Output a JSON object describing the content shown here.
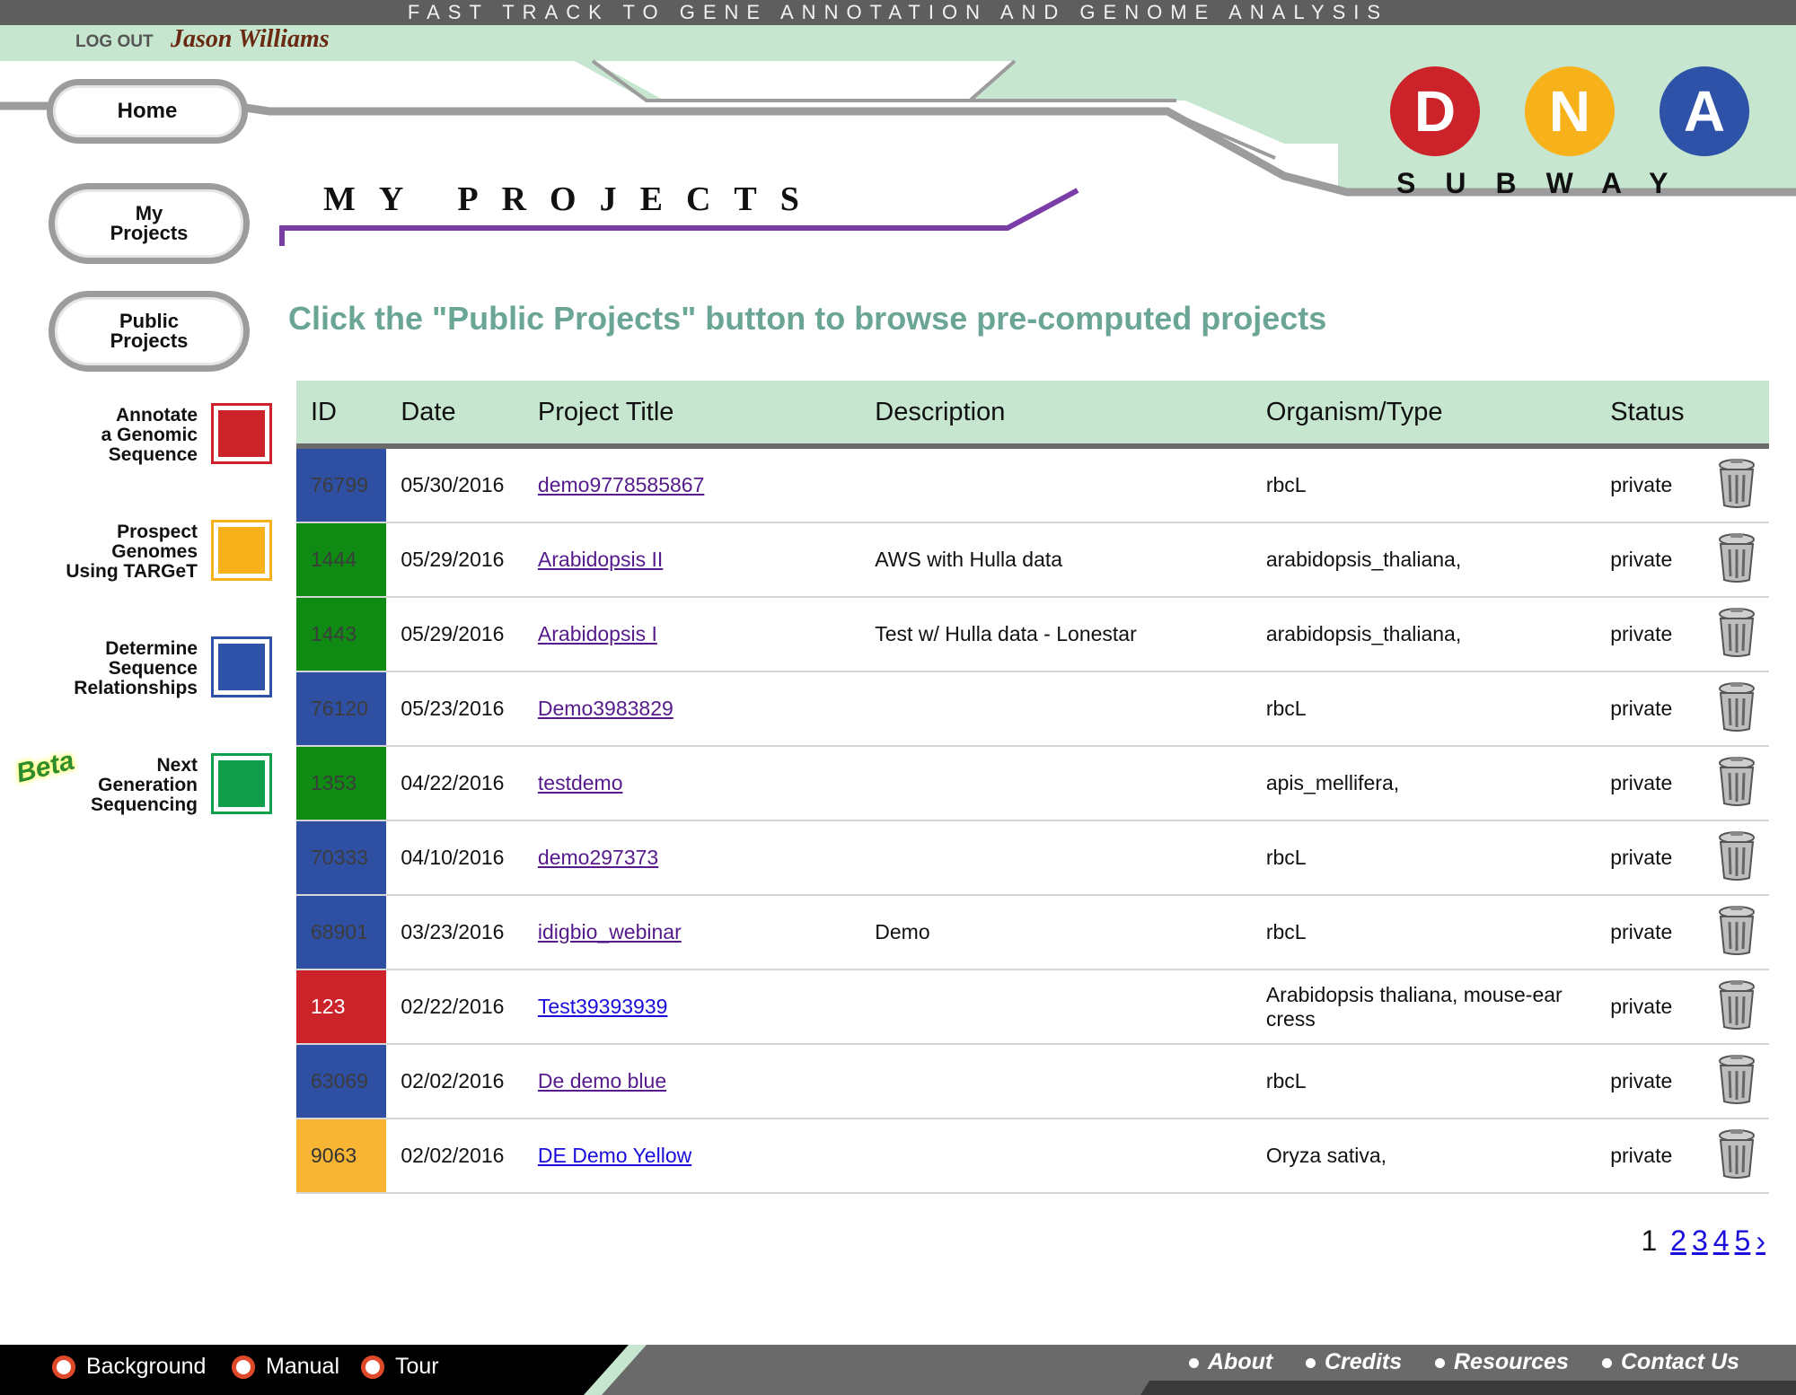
{
  "header": {
    "tagline": "FAST TRACK TO GENE ANNOTATION AND GENOME ANALYSIS",
    "logout_label": "LOG OUT",
    "username": "Jason Williams"
  },
  "logo": {
    "letters": [
      "D",
      "N",
      "A"
    ],
    "subtitle": "SUBWAY",
    "colors": [
      "#cc2229",
      "#f7b21b",
      "#2d52a8"
    ]
  },
  "nav": {
    "home": "Home",
    "my_projects": [
      "My",
      "Projects"
    ],
    "public_projects": [
      "Public",
      "Projects"
    ]
  },
  "sidebar": [
    {
      "lines": [
        "Annotate",
        "a Genomic",
        "Sequence"
      ],
      "color": "#cc2229"
    },
    {
      "lines": [
        "Prospect",
        "Genomes",
        "Using TARGeT"
      ],
      "color": "#f7b21b"
    },
    {
      "lines": [
        "Determine",
        "Sequence",
        "Relationships"
      ],
      "color": "#2d52a8"
    },
    {
      "lines": [
        "Next",
        "Generation",
        "Sequencing"
      ],
      "color": "#119e4a",
      "badge": "Beta"
    }
  ],
  "page": {
    "title": "MY PROJECTS",
    "instruction": "Click the \"Public Projects\" button to browse pre-computed projects"
  },
  "table": {
    "headers": [
      "ID",
      "Date",
      "Project Title",
      "Description",
      "Organism/Type",
      "Status"
    ],
    "rows": [
      {
        "id": "76799",
        "date": "05/30/2016",
        "title": "demo9778585867",
        "description": "",
        "organism": "rbcL",
        "status": "private",
        "color": "#2f4fa3"
      },
      {
        "id": "1444",
        "date": "05/29/2016",
        "title": "Arabidopsis II",
        "description": "AWS with Hulla data",
        "organism": "arabidopsis_thaliana,",
        "status": "private",
        "color": "#0f8a13"
      },
      {
        "id": "1443",
        "date": "05/29/2016",
        "title": "Arabidopsis I",
        "description": "Test w/ Hulla data - Lonestar",
        "organism": "arabidopsis_thaliana,",
        "status": "private",
        "color": "#0f8a13"
      },
      {
        "id": "76120",
        "date": "05/23/2016",
        "title": "Demo3983829",
        "description": "",
        "organism": "rbcL",
        "status": "private",
        "color": "#2f4fa3"
      },
      {
        "id": "1353",
        "date": "04/22/2016",
        "title": "testdemo",
        "description": "",
        "organism": "apis_mellifera,",
        "status": "private",
        "color": "#0f8a13"
      },
      {
        "id": "70333",
        "date": "04/10/2016",
        "title": "demo297373",
        "description": "",
        "organism": "rbcL",
        "status": "private",
        "color": "#2f4fa3"
      },
      {
        "id": "68901",
        "date": "03/23/2016",
        "title": "idigbio_webinar",
        "description": "Demo",
        "organism": "rbcL",
        "status": "private",
        "color": "#2f4fa3"
      },
      {
        "id": "123",
        "date": "02/22/2016",
        "title": "Test39393939",
        "description": "",
        "organism": "Arabidopsis thaliana, mouse-ear cress",
        "status": "private",
        "color": "#cc2229"
      },
      {
        "id": "63069",
        "date": "02/02/2016",
        "title": "De demo blue",
        "description": "",
        "organism": "rbcL",
        "status": "private",
        "color": "#2f4fa3"
      },
      {
        "id": "9063",
        "date": "02/02/2016",
        "title": "DE Demo Yellow",
        "description": "",
        "organism": "Oryza sativa,",
        "status": "private",
        "color": "#f7b533"
      }
    ]
  },
  "pagination": {
    "current": "1",
    "pages": [
      "2",
      "3",
      "4",
      "5"
    ],
    "next": "›"
  },
  "footer": {
    "left_links": [
      "Background",
      "Manual",
      "Tour"
    ],
    "right_links": [
      "About",
      "Credits",
      "Resources",
      "Contact Us"
    ]
  }
}
